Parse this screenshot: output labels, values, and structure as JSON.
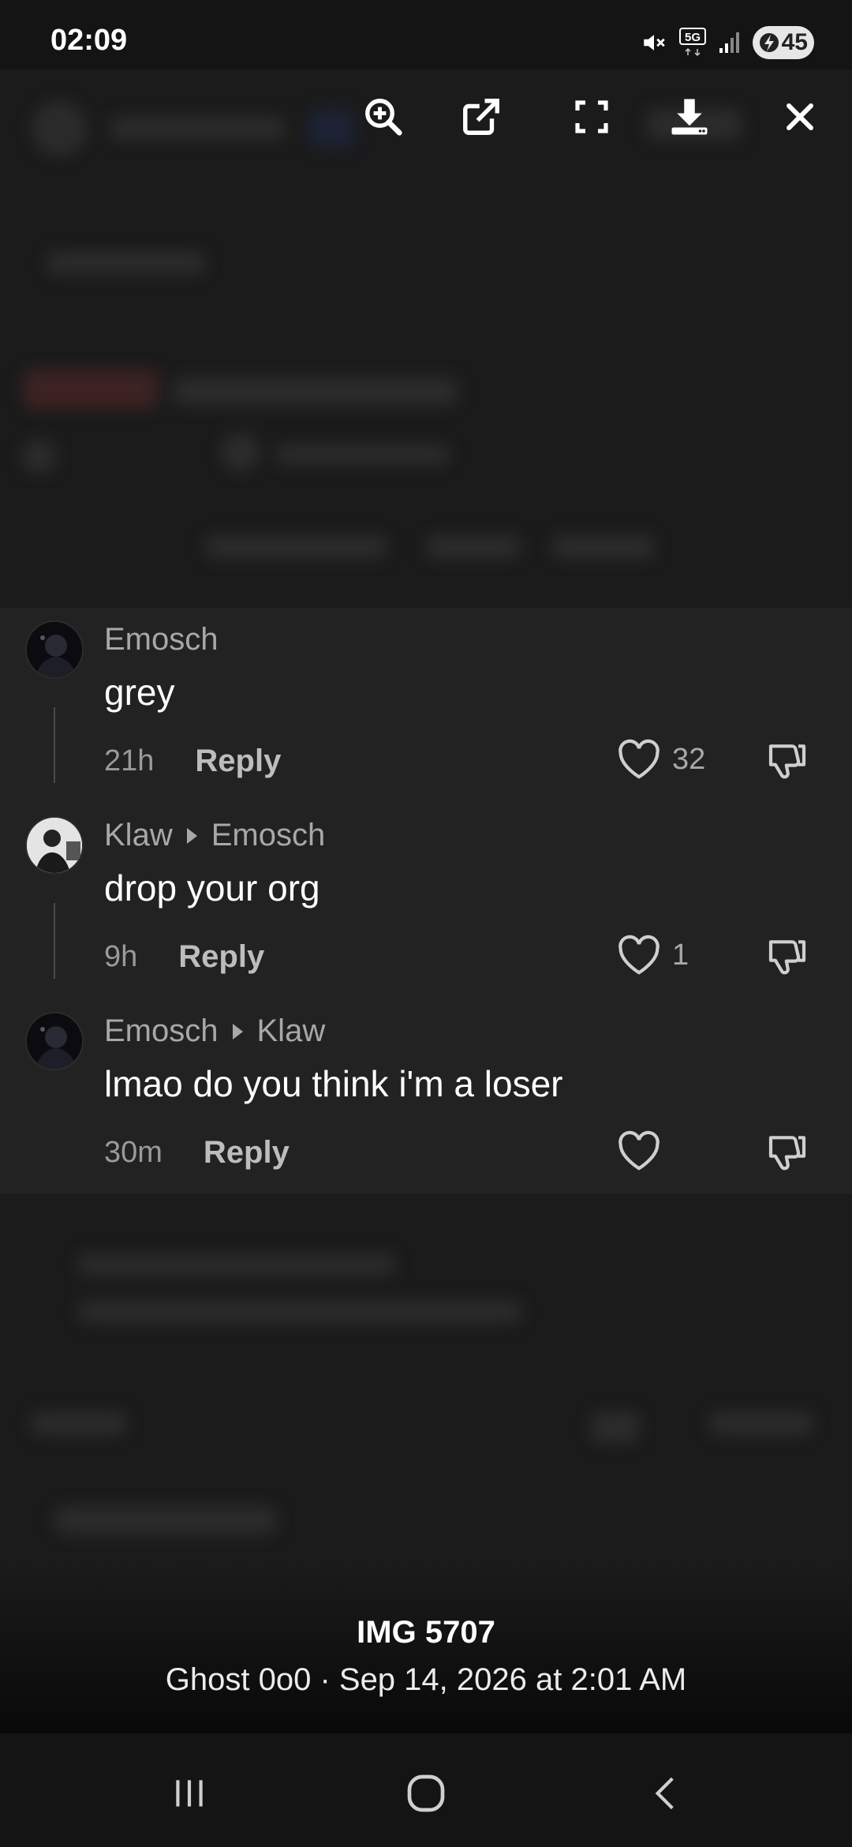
{
  "status_bar": {
    "time": "02:09",
    "battery": "45",
    "icons": [
      "mute-icon",
      "5g-icon",
      "signal-icon",
      "battery-icon"
    ]
  },
  "toolbar": {
    "buttons": [
      "zoom-in-icon",
      "open-external-icon",
      "fullscreen-icon",
      "download-icon",
      "close-icon"
    ]
  },
  "comments": [
    {
      "author": "Emosch",
      "reply_to": "",
      "text": "grey",
      "time": "21h",
      "reply_label": "Reply",
      "likes": "32"
    },
    {
      "author": "Klaw",
      "reply_to": "Emosch",
      "text": "drop your org",
      "time": "9h",
      "reply_label": "Reply",
      "likes": "1"
    },
    {
      "author": "Emosch",
      "reply_to": "Klaw",
      "text": "lmao do you think i'm a loser",
      "time": "30m",
      "reply_label": "Reply",
      "likes": ""
    }
  ],
  "caption": {
    "title": "IMG 5707",
    "subtitle": "Ghost 0o0 · Sep 14, 2026 at 2:01 AM"
  },
  "colors": {
    "background": "#161616",
    "card": "#222222",
    "muted_text": "#a8a8a8",
    "text": "#ffffff"
  }
}
